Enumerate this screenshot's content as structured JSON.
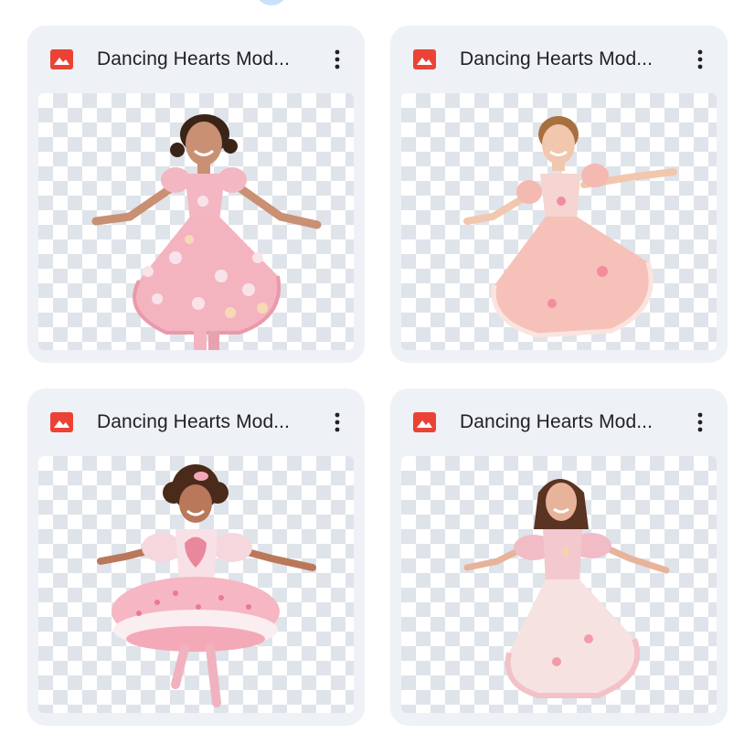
{
  "files": [
    {
      "title": "Dancing Hearts Mod...",
      "type_icon": "image-icon",
      "menu_icon": "more-vert-icon",
      "dress": "heart-applique"
    },
    {
      "title": "Dancing Hearts Mod...",
      "type_icon": "image-icon",
      "menu_icon": "more-vert-icon",
      "dress": "peach-swirl"
    },
    {
      "title": "Dancing Hearts Mod...",
      "type_icon": "image-icon",
      "menu_icon": "more-vert-icon",
      "dress": "tutu-heart"
    },
    {
      "title": "Dancing Hearts Mod...",
      "type_icon": "image-icon",
      "menu_icon": "more-vert-icon",
      "dress": "long-gown"
    }
  ],
  "colors": {
    "card_bg": "#eef1f6",
    "image_icon": "#ea4335",
    "checker": "#dfe3ea",
    "dress_pink": "#f4b6c2"
  }
}
